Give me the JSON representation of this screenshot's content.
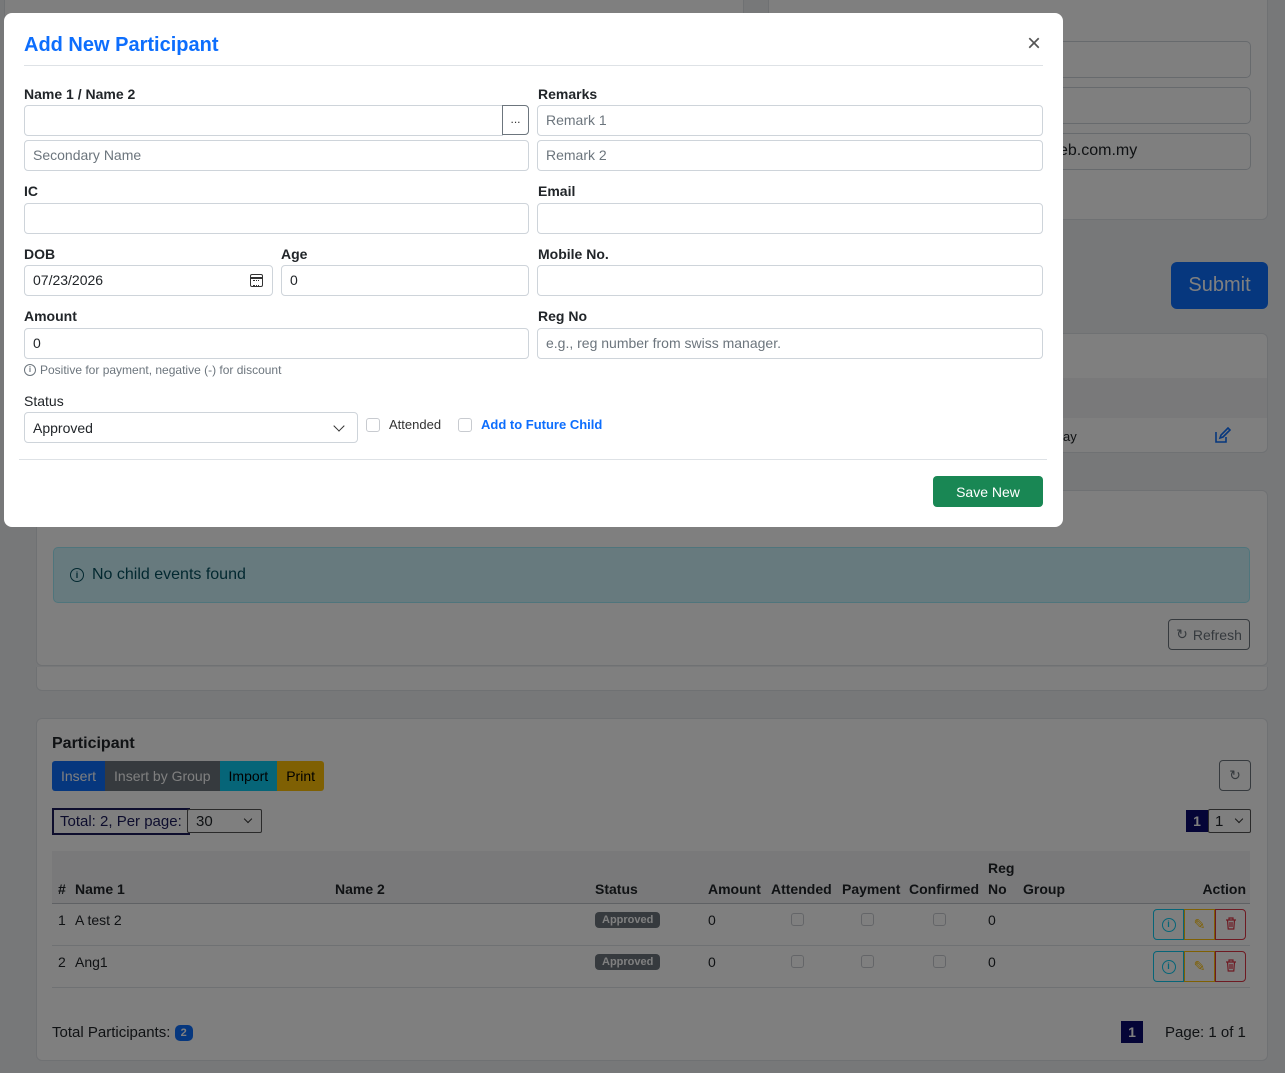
{
  "background": {
    "contact_fields": [
      "",
      "",
      "eb.com.my"
    ],
    "submit_label": "Submit",
    "table_fragment_text": "ay",
    "alert_text": "No child events found",
    "refresh_label": "Refresh",
    "participant": {
      "title": "Participant",
      "buttons": [
        "Insert",
        "Insert by Group",
        "Import",
        "Print"
      ],
      "total_label": "Total: 2, Per page:",
      "per_page_value": "30",
      "page_badge": "1",
      "page_select_value": "1",
      "columns": {
        "num": "#",
        "name1": "Name 1",
        "name2": "Name 2",
        "status": "Status",
        "amount": "Amount",
        "attended": "Attended",
        "payment": "Payment",
        "confirmed": "Confirmed",
        "regno_top": "Reg",
        "regno_bottom": "No",
        "group": "Group",
        "action": "Action"
      },
      "rows": [
        {
          "num": "1",
          "name1": "A test 2",
          "name2": "",
          "status": "Approved",
          "amount": "0",
          "regno": "0",
          "group": ""
        },
        {
          "num": "2",
          "name1": "Ang1",
          "name2": "",
          "status": "Approved",
          "amount": "0",
          "regno": "0",
          "group": ""
        }
      ],
      "total_participants_label": "Total Participants:",
      "total_participants_count": "2",
      "footer_page_badge": "1",
      "page_info": "Page: 1 of 1"
    }
  },
  "modal": {
    "title": "Add New Participant",
    "name_label": "Name 1 / Name 2",
    "name1_value": "",
    "dots_label": "...",
    "name2_placeholder": "Secondary Name",
    "remarks_label": "Remarks",
    "remark1_placeholder": "Remark 1",
    "remark2_placeholder": "Remark 2",
    "ic_label": "IC",
    "ic_value": "",
    "email_label": "Email",
    "email_value": "",
    "dob_label": "DOB",
    "dob_value": "07/23/2026",
    "age_label": "Age",
    "age_value": "0",
    "mobile_label": "Mobile No.",
    "mobile_value": "",
    "amount_label": "Amount",
    "amount_value": "0",
    "amount_help": "Positive for payment, negative (-) for discount",
    "regno_label": "Reg No",
    "regno_placeholder": "e.g., reg number from swiss manager.",
    "status_label": "Status",
    "status_value": "Approved",
    "attended_label": "Attended",
    "future_child_label": "Add to Future Child",
    "save_label": "Save New"
  },
  "colors": {
    "primary": "#0d6efd",
    "success": "#198754",
    "secondary": "#6c757d",
    "info": "#0dcaf0",
    "warning": "#ffc107",
    "danger": "#dc3545"
  }
}
